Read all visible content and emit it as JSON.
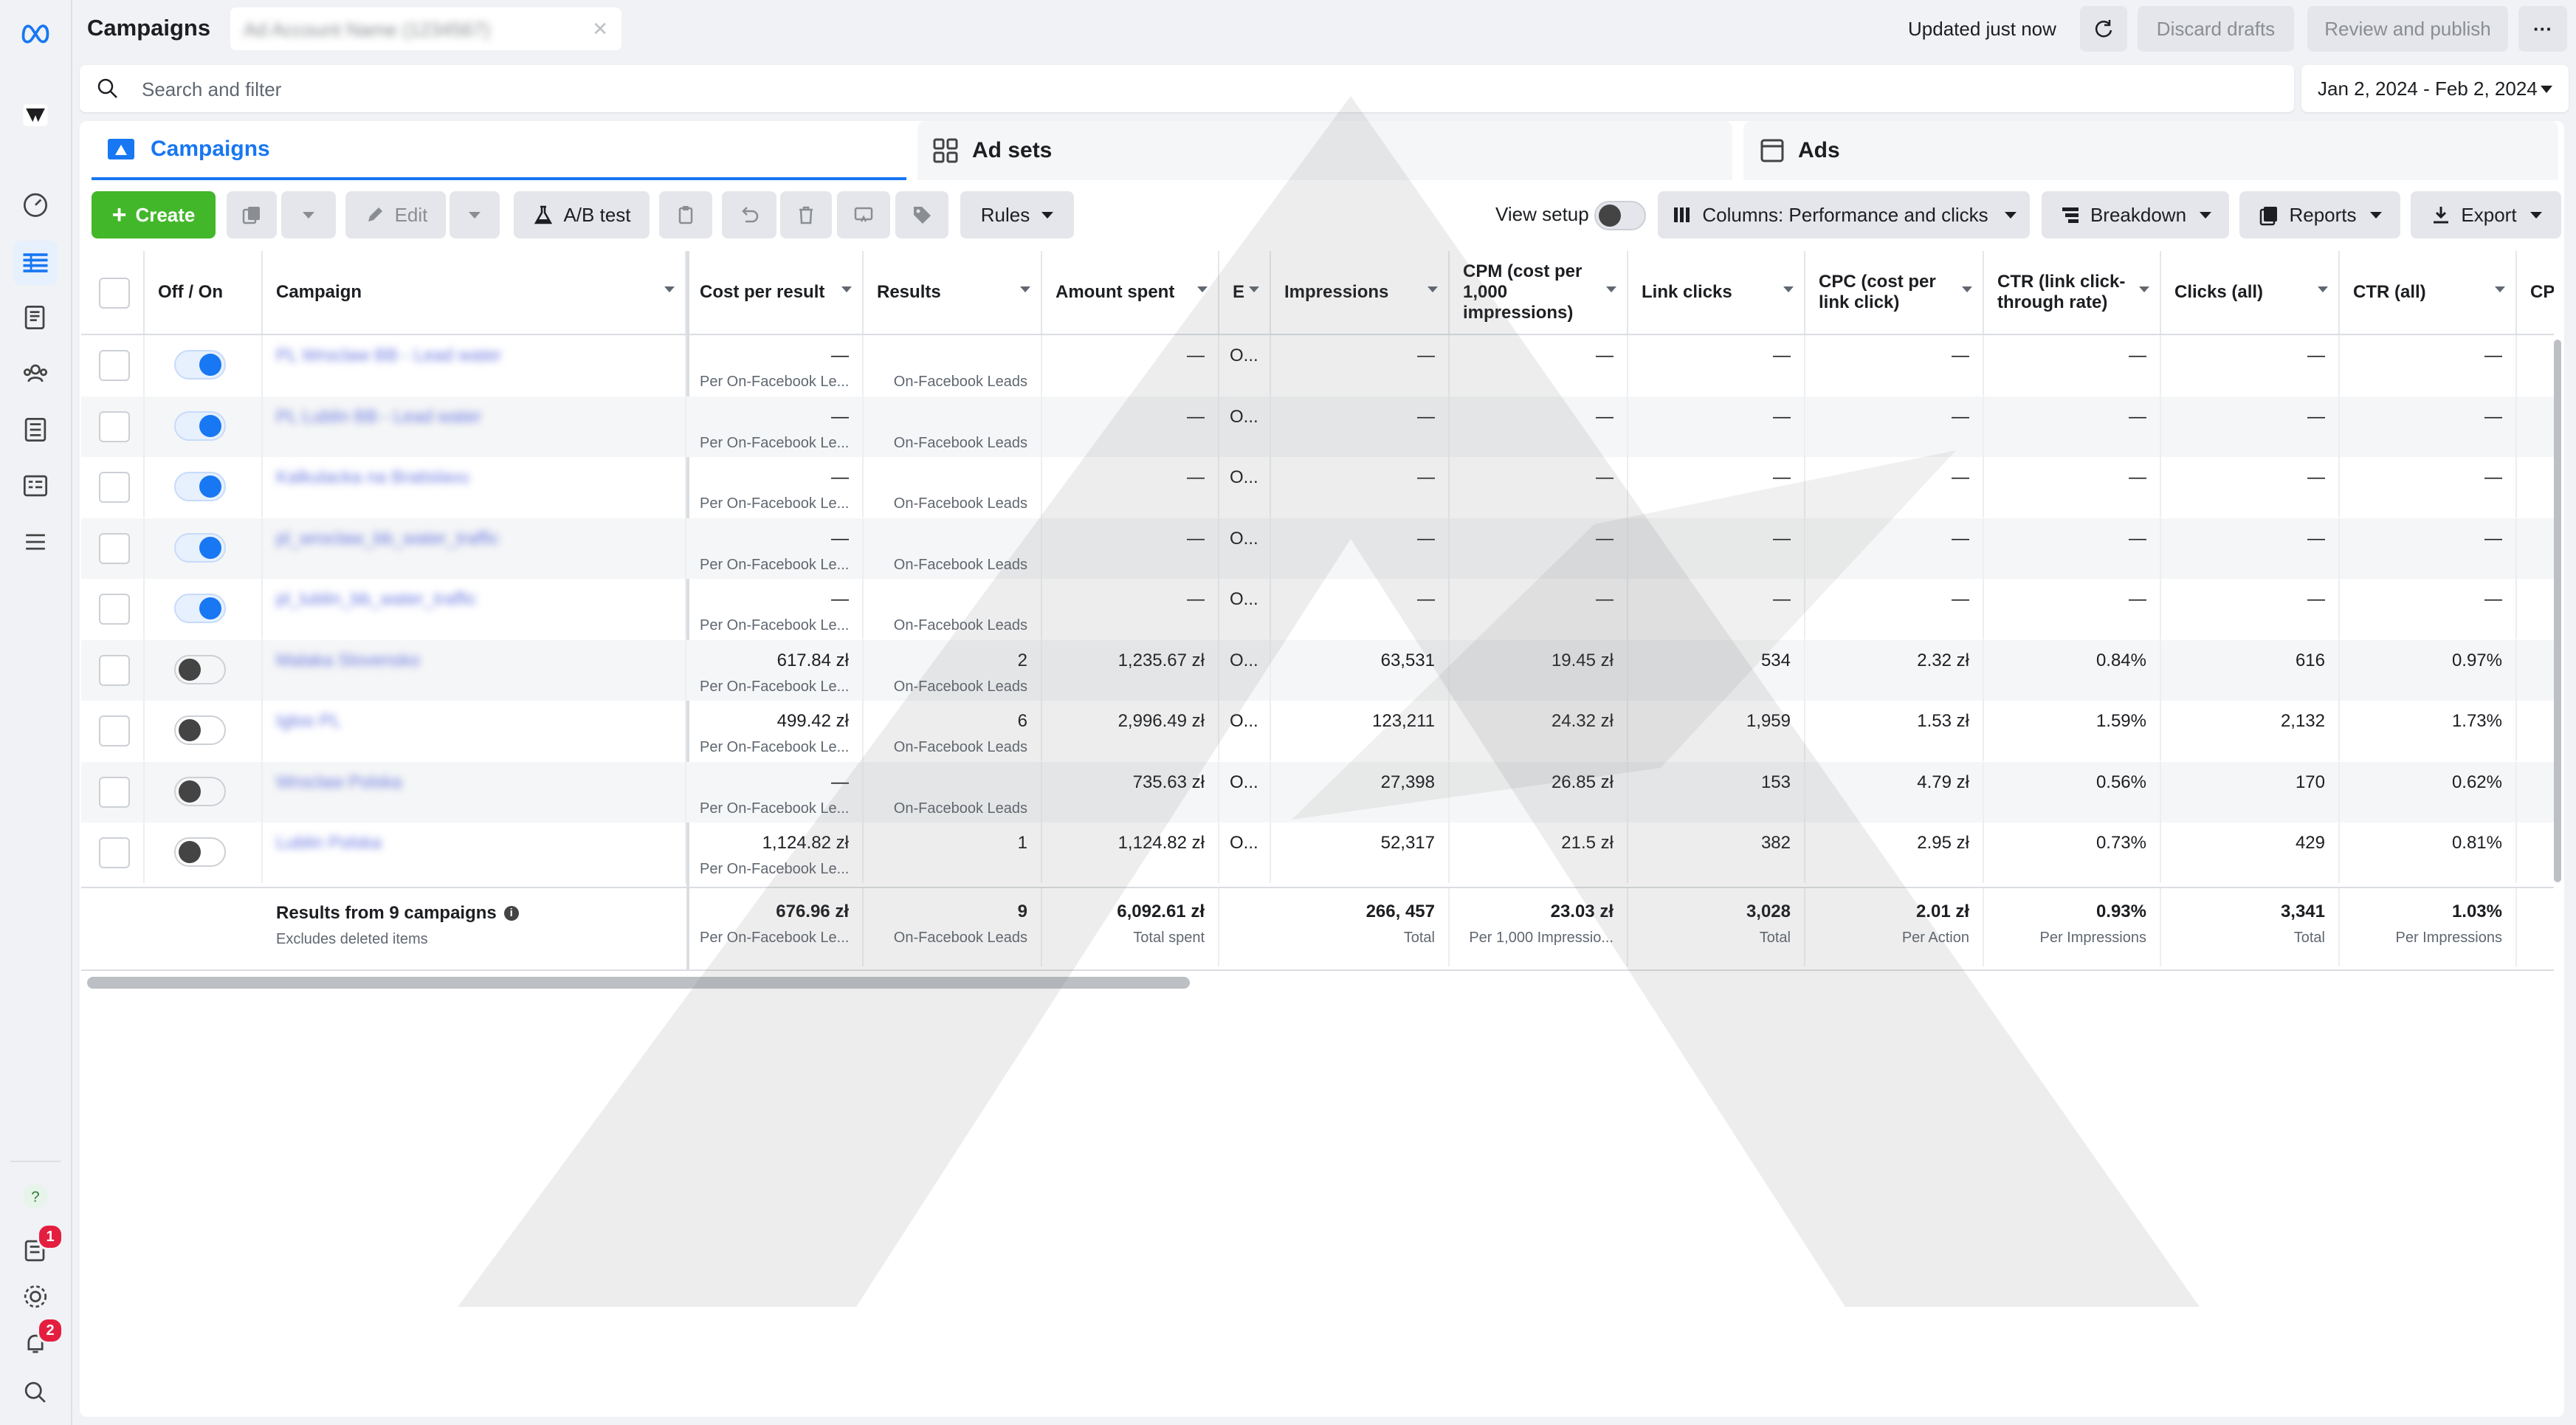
{
  "header": {
    "title": "Campaigns",
    "account_name": "Ad Account Name (1234567)",
    "updated": "Updated just now",
    "discard_label": "Discard drafts",
    "publish_label": "Review and publish",
    "more_label": "···"
  },
  "search": {
    "placeholder": "Search and filter",
    "date_range": "Jan 2, 2024 -  Feb 2, 2024"
  },
  "tabs": [
    {
      "label": "Campaigns"
    },
    {
      "label": "Ad sets"
    },
    {
      "label": "Ads"
    }
  ],
  "toolbar": {
    "create_label": "Create",
    "edit_label": "Edit",
    "ab_test_label": "A/B test",
    "rules_label": "Rules",
    "view_setup_label": "View setup",
    "columns_label": "Columns: Performance and clicks",
    "breakdown_label": "Breakdown",
    "reports_label": "Reports",
    "export_label": "Export"
  },
  "rail": {
    "help_badge": "1",
    "notif_badge": "2"
  },
  "columns": {
    "off_on": "Off / On",
    "campaign": "Campaign",
    "cost_per_result": "Cost per result",
    "results": "Results",
    "amount_spent": "Amount spent",
    "e": "E",
    "impressions": "Impressions",
    "cpm": "CPM (cost per 1,000 impressions)",
    "link_clicks": "Link clicks",
    "cpc_link": "CPC (cost per link click)",
    "ctr_link": "CTR (link click-through rate)",
    "clicks_all": "Clicks (all)",
    "ctr_all": "CTR (all)",
    "cpc": "CPC"
  },
  "rows": [
    {
      "on": true,
      "name": "PL Wroclaw BB - Lead water",
      "cpr": "—",
      "cpr_sub": "Per On-Facebook Le...",
      "results": "",
      "results_sub": "On-Facebook Leads",
      "spent": "—",
      "e": "O...",
      "impr": "—",
      "cpm": "—",
      "link": "—",
      "cpc_link": "—",
      "ctr_link": "—",
      "clicks": "—",
      "ctr_all": "—"
    },
    {
      "on": true,
      "name": "PL Lublin BB - Lead water",
      "cpr": "—",
      "cpr_sub": "Per On-Facebook Le...",
      "results": "",
      "results_sub": "On-Facebook Leads",
      "spent": "—",
      "e": "O...",
      "impr": "—",
      "cpm": "—",
      "link": "—",
      "cpc_link": "—",
      "ctr_link": "—",
      "clicks": "—",
      "ctr_all": "—"
    },
    {
      "on": true,
      "name": "Kalkulacka na Bratislavu",
      "cpr": "—",
      "cpr_sub": "Per On-Facebook Le...",
      "results": "",
      "results_sub": "On-Facebook Leads",
      "spent": "—",
      "e": "O...",
      "impr": "—",
      "cpm": "—",
      "link": "—",
      "cpc_link": "—",
      "ctr_link": "—",
      "clicks": "—",
      "ctr_all": "—"
    },
    {
      "on": true,
      "name": "pl_wroclaw_bb_water_traffic",
      "cpr": "—",
      "cpr_sub": "Per On-Facebook Le...",
      "results": "",
      "results_sub": "On-Facebook Leads",
      "spent": "—",
      "e": "O...",
      "impr": "—",
      "cpm": "—",
      "link": "—",
      "cpc_link": "—",
      "ctr_link": "—",
      "clicks": "—",
      "ctr_all": "—"
    },
    {
      "on": true,
      "name": "pl_lublin_bb_water_traffic",
      "cpr": "—",
      "cpr_sub": "Per On-Facebook Le...",
      "results": "",
      "results_sub": "On-Facebook Leads",
      "spent": "—",
      "e": "O...",
      "impr": "—",
      "cpm": "—",
      "link": "—",
      "cpc_link": "—",
      "ctr_link": "—",
      "clicks": "—",
      "ctr_all": "—"
    },
    {
      "on": false,
      "name": "Malaka Slovensko",
      "cpr": "617.84 zł",
      "cpr_sub": "Per On-Facebook Le...",
      "results": "2",
      "results_sub": "On-Facebook Leads",
      "spent": "1,235.67 zł",
      "e": "O...",
      "impr": "63,531",
      "cpm": "19.45 zł",
      "link": "534",
      "cpc_link": "2.32 zł",
      "ctr_link": "0.84%",
      "clicks": "616",
      "ctr_all": "0.97%"
    },
    {
      "on": false,
      "name": "Igloo PL",
      "cpr": "499.42 zł",
      "cpr_sub": "Per On-Facebook Le...",
      "results": "6",
      "results_sub": "On-Facebook Leads",
      "spent": "2,996.49 zł",
      "e": "O...",
      "impr": "123,211",
      "cpm": "24.32 zł",
      "link": "1,959",
      "cpc_link": "1.53 zł",
      "ctr_link": "1.59%",
      "clicks": "2,132",
      "ctr_all": "1.73%"
    },
    {
      "on": false,
      "name": "Wroclaw Polska",
      "cpr": "—",
      "cpr_sub": "Per On-Facebook Le...",
      "results": "",
      "results_sub": "On-Facebook Leads",
      "spent": "735.63 zł",
      "e": "O...",
      "impr": "27,398",
      "cpm": "26.85 zł",
      "link": "153",
      "cpc_link": "4.79 zł",
      "ctr_link": "0.56%",
      "clicks": "170",
      "ctr_all": "0.62%"
    },
    {
      "on": false,
      "name": "Lublin Polska",
      "cpr": "1,124.82 zł",
      "cpr_sub": "Per On-Facebook Le...",
      "results": "1",
      "results_sub": "",
      "spent": "1,124.82 zł",
      "e": "O...",
      "impr": "52,317",
      "cpm": "21.5 zł",
      "link": "382",
      "cpc_link": "2.95 zł",
      "ctr_link": "0.73%",
      "clicks": "429",
      "ctr_all": "0.81%"
    }
  ],
  "totals": {
    "label": "Results from 9 campaigns",
    "sub": "Excludes deleted items",
    "cpr": "676.96 zł",
    "cpr_sub": "Per On-Facebook Le...",
    "results": "9",
    "results_sub": "On-Facebook Leads",
    "spent": "6,092.61 zł",
    "spent_sub": "Total spent",
    "impr": "266, 457",
    "impr_sub": "Total",
    "cpm": "23.03 zł",
    "cpm_sub": "Per 1,000 Impressio...",
    "link": "3,028",
    "link_sub": "Total",
    "cpc_link": "2.01 zł",
    "cpc_link_sub": "Per Action",
    "ctr_link": "0.93%",
    "ctr_link_sub": "Per Impressions",
    "clicks": "3,341",
    "clicks_sub": "Total",
    "ctr_all": "1.03%",
    "ctr_all_sub": "Per Impressions"
  },
  "colors": {
    "accent": "#1877f2",
    "create": "#42b72a",
    "badge": "#e41e3f"
  }
}
